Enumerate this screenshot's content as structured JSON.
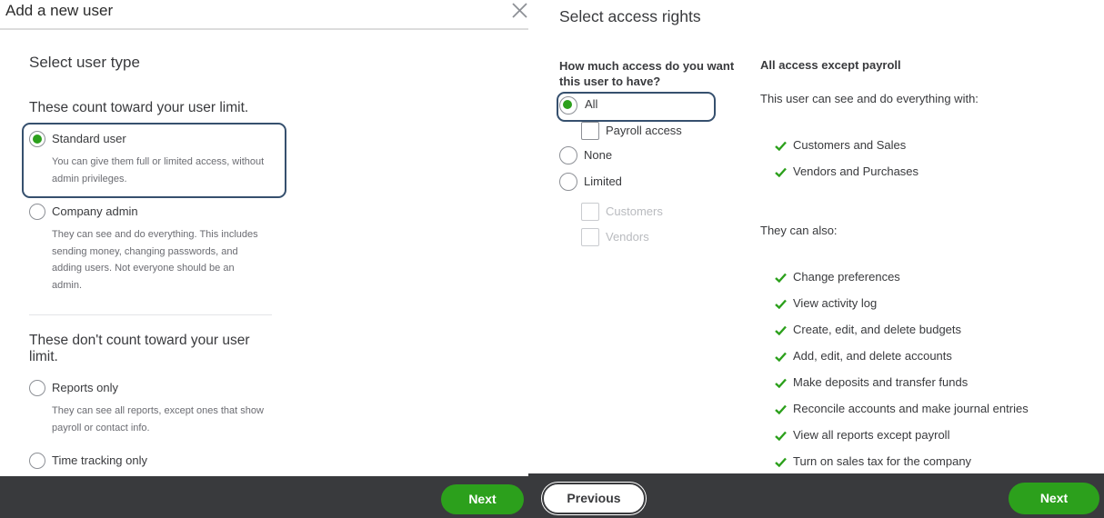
{
  "left_dialog": {
    "title": "Add a new user",
    "section_title": "Select user type",
    "group_counting": "These count toward your user limit.",
    "group_not_counting": "These don't count toward your user limit.",
    "options": [
      {
        "label": "Standard user",
        "desc_lines": [
          "You can give them full or limited access, without",
          "admin privileges."
        ],
        "selected": true
      },
      {
        "label": "Company admin",
        "desc_lines": [
          "They can see and do everything. This includes",
          "sending money, changing passwords, and",
          "adding users. Not everyone should be an",
          "admin."
        ],
        "selected": false
      },
      {
        "label": "Reports only",
        "desc_lines": [
          "They can see all reports, except ones that show",
          "payroll or contact info."
        ],
        "selected": false
      },
      {
        "label": "Time tracking only",
        "desc_lines": [],
        "selected": false
      }
    ],
    "next_label": "Next"
  },
  "right_dialog": {
    "title": "Select access rights",
    "question": "How much access do you want this user to have?",
    "access_options": {
      "all": "All",
      "payroll_access": "Payroll access",
      "none": "None",
      "limited": "Limited",
      "customers": "Customers",
      "vendors": "Vendors"
    },
    "summary_title": "All access except payroll",
    "summary_intro": "This user can see and do everything with:",
    "core_permissions": [
      "Customers and Sales",
      "Vendors and Purchases"
    ],
    "also_intro": "They can also:",
    "extra_permissions": [
      "Change preferences",
      "View activity log",
      "Create, edit, and delete budgets",
      "Add, edit, and delete accounts",
      "Make deposits and transfer funds",
      "Reconcile accounts and make journal entries",
      "View all reports except payroll",
      "Turn on sales tax for the company"
    ],
    "previous_label": "Previous",
    "next_label": "Next"
  },
  "colors": {
    "accent_green": "#2ca01c",
    "footer": "#393a3d",
    "highlight_border": "#36506e"
  }
}
